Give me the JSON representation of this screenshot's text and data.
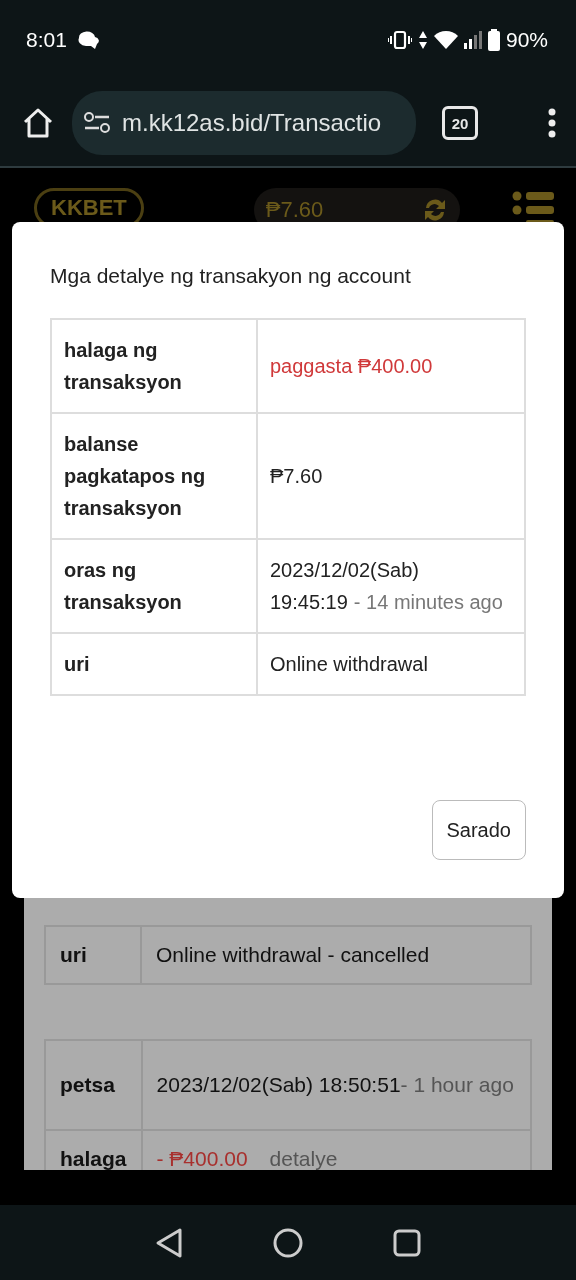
{
  "status_bar": {
    "time": "8:01",
    "battery": "90%"
  },
  "browser": {
    "url": "m.kk12as.bid/Transactio",
    "tab_count": "20"
  },
  "site_header": {
    "logo": "KKBET",
    "balance": "₱7.60"
  },
  "background_records": [
    {
      "rows": [
        {
          "kind": "text",
          "label": "uri",
          "value": "Online withdrawal - cancelled"
        }
      ]
    },
    {
      "rows": [
        {
          "kind": "time",
          "label": "petsa",
          "value": "2023/12/02(Sab) 18:50:51",
          "note": "- 1 hour ago"
        },
        {
          "kind": "amount",
          "label": "halaga",
          "value": "- ₱400.00",
          "link": "detalye"
        }
      ]
    }
  ],
  "modal": {
    "title": "Mga detalye ng transakyon ng account",
    "rows": [
      {
        "kind": "amount",
        "label": "halaga ng transaksyon",
        "value": "paggasta ₱400.00"
      },
      {
        "kind": "text",
        "label": "balanse pagkatapos ng transaksyon",
        "value": "₱7.60"
      },
      {
        "kind": "time",
        "label": "oras ng transaksyon",
        "value": "2023/12/02(Sab) 19:45:19",
        "note": "- 14 minutes ago"
      },
      {
        "kind": "text",
        "label": "uri",
        "value": "Online withdrawal"
      }
    ],
    "close_button": "Sarado"
  }
}
